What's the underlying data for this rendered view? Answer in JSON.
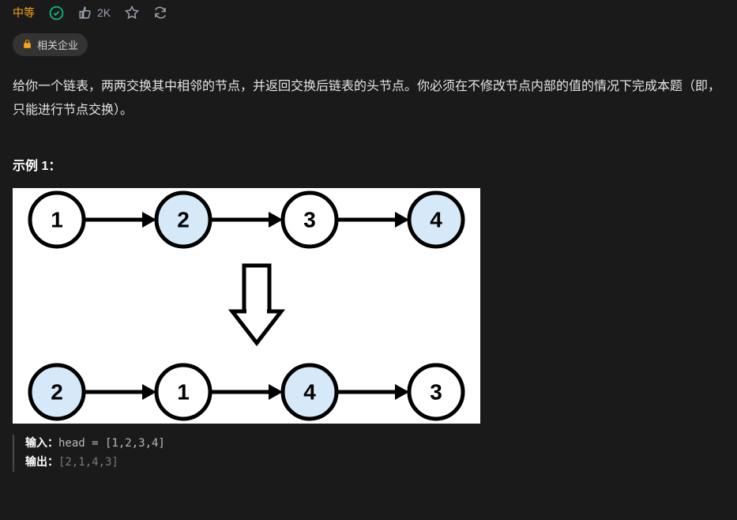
{
  "header": {
    "difficulty": "中等",
    "likes": "2K",
    "tag_label": "相关企业"
  },
  "description": "给你一个链表，两两交换其中相邻的节点，并返回交换后链表的头节点。你必须在不修改节点内部的值的情况下完成本题（即，只能进行节点交换）。",
  "example": {
    "label": "示例 1：",
    "input_label": "输入：",
    "input_value": "head = [1,2,3,4]",
    "output_label": "输出：",
    "output_value": "[2,1,4,3]"
  },
  "diagram": {
    "before": [
      "1",
      "2",
      "3",
      "4"
    ],
    "after": [
      "2",
      "1",
      "4",
      "3"
    ],
    "highlighted_before": [
      1,
      3
    ],
    "highlighted_after": [
      0,
      2
    ]
  }
}
